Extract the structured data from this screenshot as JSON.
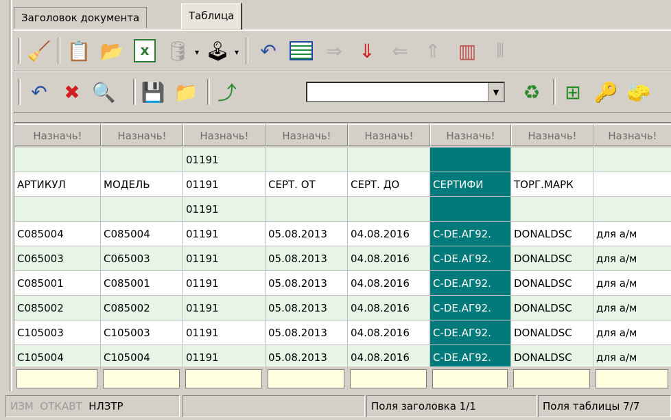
{
  "tabs": [
    {
      "label": "Заголовок документа",
      "active": false
    },
    {
      "label": "Таблица",
      "active": true
    }
  ],
  "combo": {
    "value": ""
  },
  "header_cells": [
    "Назначь!",
    "Назначь!",
    "Назначь!",
    "Назначь!",
    "Назначь!",
    "Назначь!",
    "Назначь!",
    "Назначь!"
  ],
  "rows": [
    [
      "",
      "",
      "01191",
      "",
      "",
      "",
      "",
      ""
    ],
    [
      "АРТИКУЛ",
      "МОДЕЛЬ",
      "01191",
      "СЕРТ. ОТ",
      "СЕРТ. ДО",
      "СЕРТИФИ",
      "ТОРГ.МАРК",
      ""
    ],
    [
      "",
      "",
      "01191",
      "",
      "",
      "",
      "",
      ""
    ],
    [
      "C085004",
      "C085004",
      "01191",
      "05.08.2013",
      "04.08.2016",
      "C-DE.АГ92.",
      "DONALDSC",
      "для а/м"
    ],
    [
      "C065003",
      "C065003",
      "01191",
      "05.08.2013",
      "04.08.2016",
      "C-DE.АГ92.",
      "DONALDSC",
      "для а/м"
    ],
    [
      "C085001",
      "C085001",
      "01191",
      "05.08.2013",
      "04.08.2016",
      "C-DE.АГ92.",
      "DONALDSC",
      "для а/м"
    ],
    [
      "C085002",
      "C085002",
      "01191",
      "05.08.2013",
      "04.08.2016",
      "C-DE.АГ92.",
      "DONALDSC",
      "для а/м"
    ],
    [
      "C105003",
      "C105003",
      "01191",
      "05.08.2013",
      "04.08.2016",
      "C-DE.АГ92.",
      "DONALDSC",
      "для а/м"
    ],
    [
      "C105004",
      "C105004",
      "01191",
      "05.08.2013",
      "04.08.2016",
      "C-DE.АГ92.",
      "DONALDSC",
      "для а/м"
    ]
  ],
  "status": {
    "izm": "ИЗМ",
    "otkavt": "ОТКАВТ",
    "nlztr": "НЛЗТР",
    "header_fields": "Поля заголовка 1/1",
    "table_fields": "Поля таблицы 7/7"
  },
  "colors": {
    "selected_column": "#007a7a",
    "alt_row": "#e6f5e6",
    "footer_cells": "#ffffe0"
  }
}
